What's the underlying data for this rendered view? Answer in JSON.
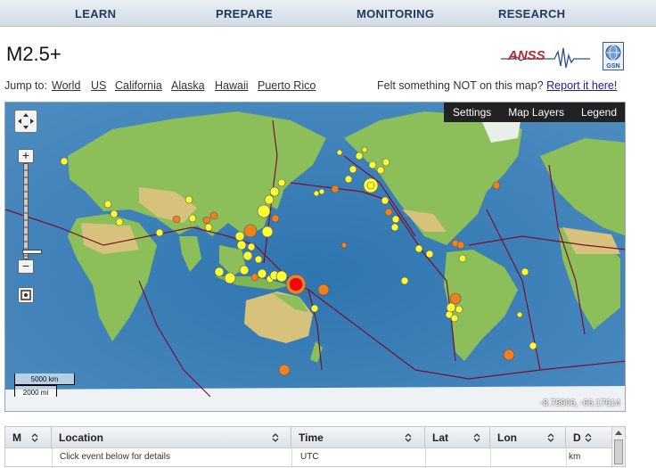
{
  "nav": {
    "items": [
      "LEARN",
      "PREPARE",
      "MONITORING",
      "RESEARCH"
    ]
  },
  "header": {
    "title": "M2.5+",
    "logo_anss": "ANSS",
    "logo_gsn": "GSN"
  },
  "jump": {
    "label": "Jump to:",
    "links": [
      "World",
      "US",
      "California",
      "Alaska",
      "Hawaii",
      "Puerto Rico"
    ],
    "felt_text": "Felt something NOT on this map?",
    "felt_link": "Report it here!"
  },
  "map": {
    "toolbar": [
      "Settings",
      "Map Layers",
      "Legend"
    ],
    "scale_top": "5000 km",
    "scale_bottom": "2000 mi",
    "coords": "-8.78906, -66.17614",
    "colors": {
      "ocean": "#3c7db3",
      "land": "#8cbf5a",
      "desert": "#d6c27a",
      "plate_boundary": "#7a1030",
      "quake_recent": "#ff0000",
      "quake_day": "#f08020",
      "quake_week": "#ffff33"
    },
    "icons": [
      "pan-icon",
      "zoom-in-icon",
      "zoom-out-icon",
      "locate-icon"
    ]
  },
  "table": {
    "columns": [
      "M",
      "Location",
      "Time",
      "Lat",
      "Lon",
      "D"
    ],
    "sub_location": "Click event below for details",
    "sub_time": "UTC",
    "sub_depth": "km"
  }
}
